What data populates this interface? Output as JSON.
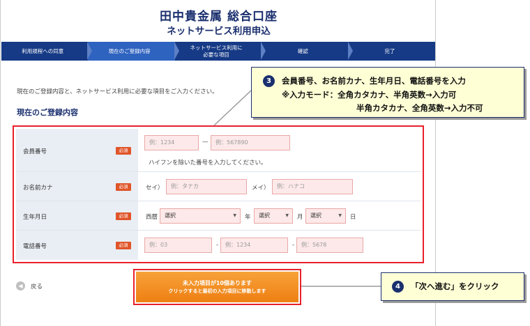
{
  "header": {
    "title": "田中貴金属 総合口座",
    "subtitle": "ネットサービス利用申込"
  },
  "steps": [
    {
      "label": "利用規程への同意",
      "active": false
    },
    {
      "label": "現在のご登録内容",
      "active": true
    },
    {
      "label": "ネットサービス利用に\n必要な項目",
      "active": false
    },
    {
      "label": "確認",
      "active": false
    },
    {
      "label": "完了",
      "active": false
    }
  ],
  "intro": "現在のご登録内容と、ネットサービス利用に必要な項目をご入力ください。",
  "section_title": "現在のご登録内容",
  "required_label": "必須",
  "form": {
    "member": {
      "label": "会員番号",
      "field1_placeholder": "例：1234",
      "dash": "—",
      "field2_placeholder": "例：567890",
      "hint": "ハイフンを除いた番号を入力してください。"
    },
    "kana": {
      "label": "お名前カナ",
      "sei_label": "セイ）",
      "sei_placeholder": "例：タナカ",
      "mei_label": "メイ）",
      "mei_placeholder": "例：ハナコ"
    },
    "birth": {
      "label": "生年月日",
      "era": "西暦",
      "year_value": "選択",
      "year_unit": "年",
      "month_value": "選択",
      "month_unit": "月",
      "day_value": "選択",
      "day_unit": "日"
    },
    "phone": {
      "label": "電話番号",
      "p1_placeholder": "例：03",
      "sep": "-",
      "p2_placeholder": "例：1234",
      "p3_placeholder": "例：5678"
    }
  },
  "back_label": "戻る",
  "next_button": {
    "line1": "未入力項目が10個あります",
    "line2": "クリックすると最初の入力項目に移動します"
  },
  "callout3": {
    "number": "3",
    "line1": "会員番号、お名前カナ、生年月日、電話番号を入力",
    "line2": "※入力モード：全角カタカナ、半角英数→入力可",
    "line3": "半角カタカナ、全角英数→入力不可"
  },
  "callout4": {
    "number": "4",
    "text": "「次へ進む」をクリック"
  },
  "colors": {
    "navy": "#163a86",
    "active_step": "#2f63c0",
    "highlight_red": "#e8202a",
    "button_orange": "#ee7f12",
    "callout_bg": "#ffffd6"
  }
}
